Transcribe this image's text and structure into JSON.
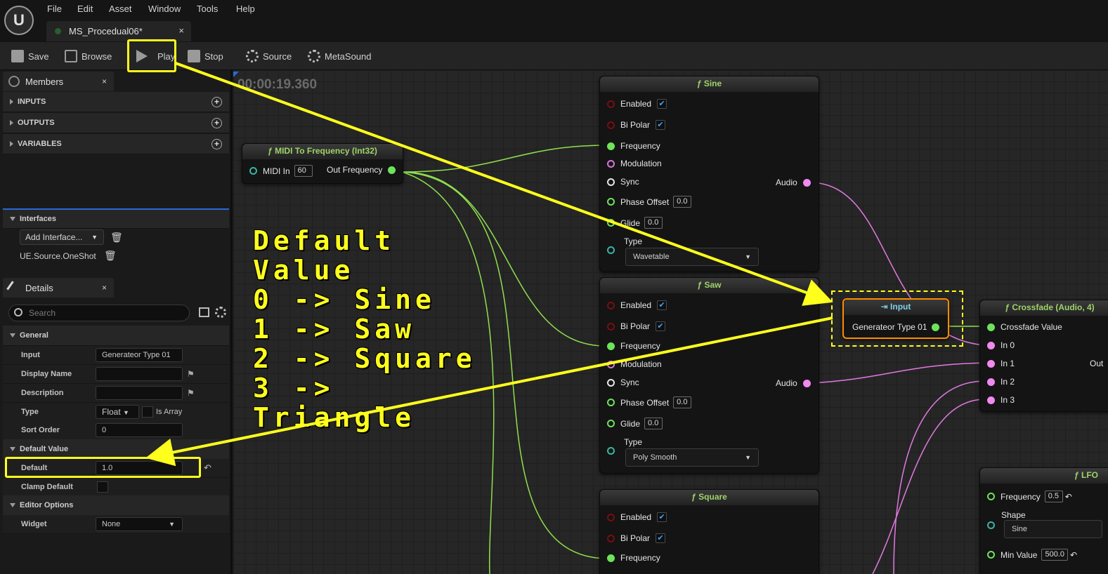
{
  "menu": [
    "File",
    "Edit",
    "Asset",
    "Window",
    "Tools",
    "Help"
  ],
  "logo": "U",
  "doc_tab": {
    "title": "MS_Procedual06*",
    "close": "×"
  },
  "toolbar": {
    "save": "Save",
    "browse": "Browse",
    "play": "Play",
    "stop": "Stop",
    "source": "Source",
    "metasound": "MetaSound"
  },
  "members": {
    "tab": "Members",
    "close": "×",
    "sections": [
      "INPUTS",
      "OUTPUTS",
      "VARIABLES"
    ],
    "interfaces_label": "Interfaces",
    "add_interface": "Add Interface...",
    "interface_item": "UE.Source.OneShot"
  },
  "details": {
    "tab": "Details",
    "close": "×",
    "search_placeholder": "Search",
    "general": "General",
    "input_label": "Input",
    "input_value": "Generateor Type 01",
    "display_name_label": "Display Name",
    "description_label": "Description",
    "type_label": "Type",
    "type_value": "Float",
    "is_array": "Is Array",
    "sort_order_label": "Sort Order",
    "sort_order_value": "0",
    "default_value_section": "Default Value",
    "default_label": "Default",
    "default_value": "1.0",
    "clamp_default_label": "Clamp Default",
    "editor_options": "Editor Options",
    "widget_label": "Widget",
    "widget_value": "None"
  },
  "graph": {
    "timecode": "00:00:19.360",
    "midi_node": {
      "title": "ƒ MIDI To Frequency (Int32)",
      "midi_in": "MIDI In",
      "midi_in_value": "60",
      "out": "Out Frequency"
    },
    "sine_node": {
      "title": "ƒ Sine",
      "enabled": "Enabled",
      "bipolar": "Bi Polar",
      "frequency": "Frequency",
      "modulation": "Modulation",
      "sync": "Sync",
      "phase_offset": "Phase Offset",
      "phase_value": "0.0",
      "glide": "Glide",
      "glide_value": "0.0",
      "type": "Type",
      "type_value": "Wavetable",
      "audio": "Audio"
    },
    "saw_node": {
      "title": "ƒ Saw",
      "enabled": "Enabled",
      "bipolar": "Bi Polar",
      "frequency": "Frequency",
      "modulation": "Modulation",
      "sync": "Sync",
      "phase_offset": "Phase Offset",
      "phase_value": "0.0",
      "glide": "Glide",
      "glide_value": "0.0",
      "type": "Type",
      "type_value": "Poly Smooth",
      "audio": "Audio"
    },
    "square_node": {
      "title": "ƒ Square",
      "enabled": "Enabled",
      "bipolar": "Bi Polar",
      "frequency": "Frequency"
    },
    "input_node": {
      "title": "Input",
      "pin": "Generateor Type 01"
    },
    "crossfade_node": {
      "title": "ƒ Crossfade (Audio, 4)",
      "value": "Crossfade Value",
      "in0": "In 0",
      "in1": "In 1",
      "in2": "In 2",
      "in3": "In 3",
      "out": "Out"
    },
    "lfo_node": {
      "title": "ƒ LFO",
      "frequency": "Frequency",
      "frequency_value": "0.5",
      "shape": "Shape",
      "shape_value": "Sine",
      "min_value": "Min Value",
      "min_value_value": "500.0"
    },
    "checkmark": "✔",
    "reset_icon": "↶"
  },
  "annotation": {
    "lines": [
      "Default Value",
      "0 -> Sine",
      "1 -> Saw",
      "2 -> Square",
      "3 -> Triangle"
    ]
  },
  "colors": {
    "accent_yellow": "#ffff1e",
    "audio_pin": "#f08af0",
    "float_pin": "#6ee25a",
    "input_highlight": "#ff8c00"
  }
}
